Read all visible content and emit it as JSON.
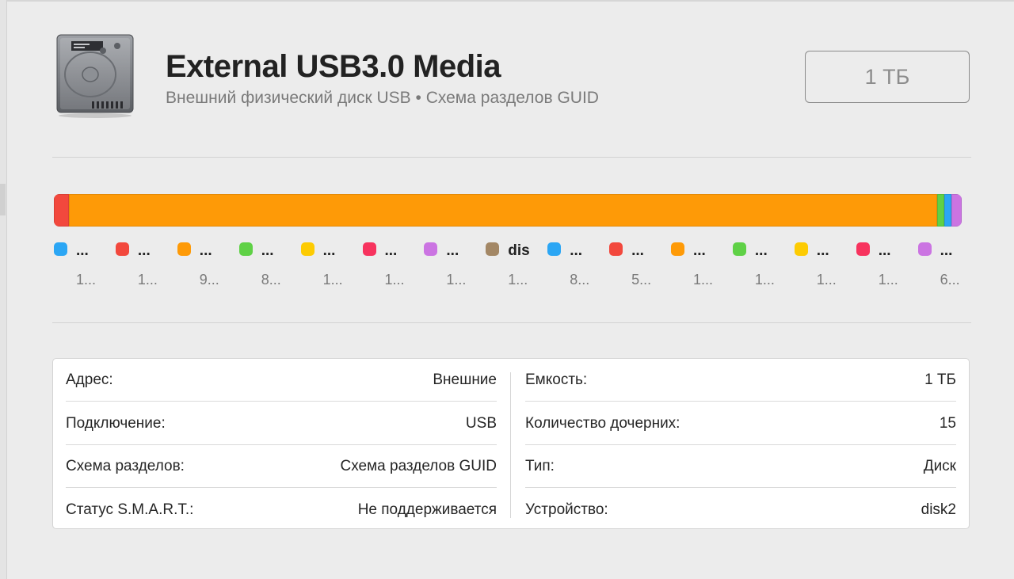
{
  "header": {
    "title": "External USB3.0 Media",
    "subtitle": "Внешний физический диск USB • Схема разделов GUID",
    "capacity": "1 ТБ"
  },
  "colors": {
    "blue": "#2ba6f4",
    "red": "#f2483d",
    "orange": "#fe9a07",
    "green": "#5fd146",
    "yellow": "#fdcb02",
    "pink": "#f7335e",
    "purple": "#cb74e2",
    "brown": "#a38765"
  },
  "usage": {
    "segments": [
      {
        "color": "#f2483d",
        "fraction": 0.017
      },
      {
        "color": "#fe9a07",
        "fraction": 0.956
      },
      {
        "color": "#5fd146",
        "fraction": 0.008
      },
      {
        "color": "#2ba6f4",
        "fraction": 0.008
      },
      {
        "color": "#cb74e2",
        "fraction": 0.011
      }
    ]
  },
  "legend": [
    {
      "name": "...",
      "size": "1...",
      "color": "#2ba6f4"
    },
    {
      "name": "...",
      "size": "1...",
      "color": "#f2483d"
    },
    {
      "name": "...",
      "size": "9...",
      "color": "#fe9a07"
    },
    {
      "name": "...",
      "size": "8...",
      "color": "#5fd146"
    },
    {
      "name": "...",
      "size": "1...",
      "color": "#fdcb02"
    },
    {
      "name": "...",
      "size": "1...",
      "color": "#f7335e"
    },
    {
      "name": "...",
      "size": "1...",
      "color": "#cb74e2"
    },
    {
      "name": "dis",
      "size": "1...",
      "color": "#a38765"
    },
    {
      "name": "...",
      "size": "8...",
      "color": "#2ba6f4"
    },
    {
      "name": "...",
      "size": "5...",
      "color": "#f2483d"
    },
    {
      "name": "...",
      "size": "1...",
      "color": "#fe9a07"
    },
    {
      "name": "...",
      "size": "1...",
      "color": "#5fd146"
    },
    {
      "name": "...",
      "size": "1...",
      "color": "#fdcb02"
    },
    {
      "name": "...",
      "size": "1...",
      "color": "#f7335e"
    },
    {
      "name": "...",
      "size": "6...",
      "color": "#cb74e2"
    }
  ],
  "info": {
    "left": [
      {
        "key": "Адрес:",
        "value": "Внешние"
      },
      {
        "key": "Подключение:",
        "value": "USB"
      },
      {
        "key": "Схема разделов:",
        "value": "Схема разделов GUID"
      },
      {
        "key": "Статус S.M.A.R.T.:",
        "value": "Не поддерживается"
      }
    ],
    "right": [
      {
        "key": "Емкость:",
        "value": "1 ТБ"
      },
      {
        "key": "Количество дочерних:",
        "value": "15"
      },
      {
        "key": "Тип:",
        "value": "Диск"
      },
      {
        "key": "Устройство:",
        "value": "disk2"
      }
    ]
  }
}
